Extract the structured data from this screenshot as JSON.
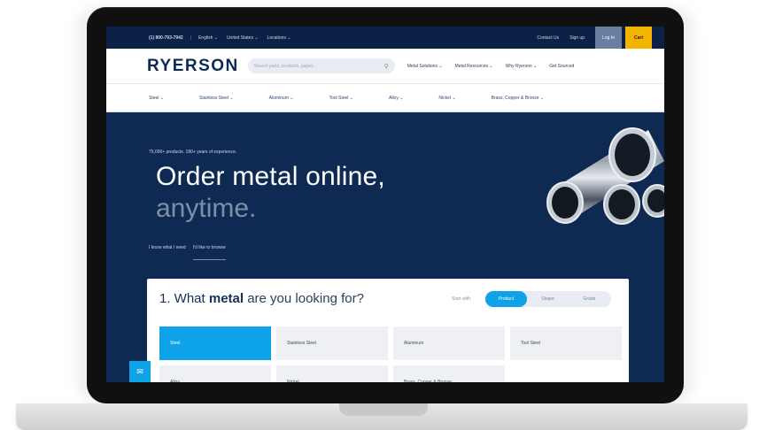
{
  "utility_bar": {
    "phone": "(1) 800-793-7942",
    "separator": "|",
    "language": "English ⌄",
    "country": "United States ⌄",
    "locations": "Locations ⌄",
    "contact": "Contact Us",
    "signup": "Sign up",
    "login": "Log In",
    "cart": "Cart"
  },
  "header": {
    "logo": "RYERSON",
    "search_placeholder": "Search parts, products, pages…",
    "nav": [
      "Metal Solutions ⌄",
      "Metal Resources ⌄",
      "Why Ryerson ⌄",
      "Get Sourced"
    ]
  },
  "categories": [
    "Steel ⌄",
    "Stainless Steel ⌄",
    "Aluminum ⌄",
    "Tool Steel ⌄",
    "Alloy ⌄",
    "Nickel ⌄",
    "Brass, Copper & Bronze ⌄"
  ],
  "hero": {
    "eyebrow": "75,000+ products. 180+ years of experience.",
    "headline_1": "Order metal online,",
    "headline_2": "anytime.",
    "tab_1": "I know what I need",
    "tab_2": "I'd like to browse"
  },
  "card": {
    "question_num": "1. What ",
    "question_bold": "metal",
    "question_rest": " are you looking for?",
    "start_with": "Start with:",
    "segments": [
      "Product",
      "Shape",
      "Grade"
    ],
    "tiles": [
      "Steel",
      "Stainless Steel",
      "Aluminum",
      "Tool Steel",
      "Alloy",
      "Nickel",
      "Brass, Copper & Bronze"
    ]
  },
  "colors": {
    "navy": "#0f2a52",
    "accent_blue": "#0ea3e8",
    "cart_yellow": "#f3b400"
  },
  "icons": {
    "search": "search-icon",
    "chat": "chat-icon"
  }
}
